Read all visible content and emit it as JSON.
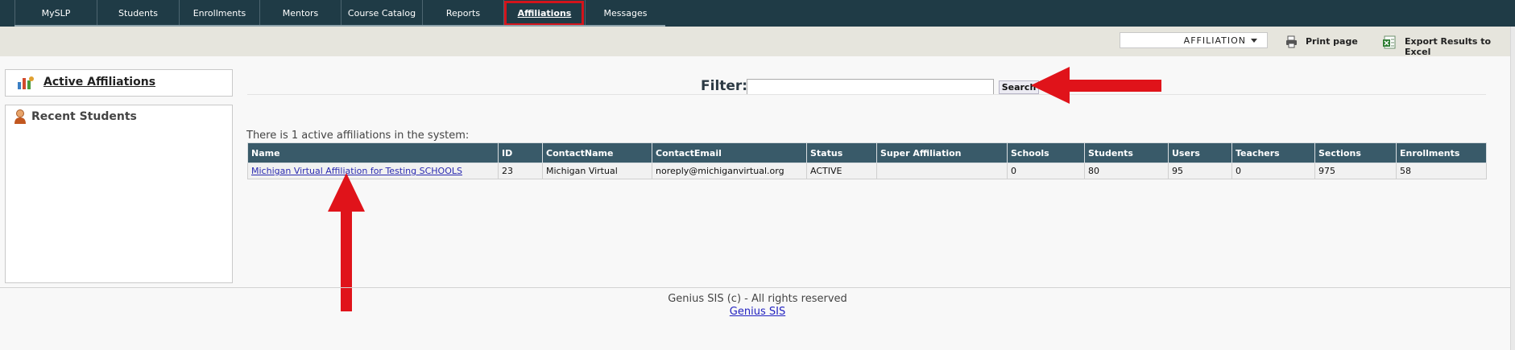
{
  "nav": {
    "tabs": [
      {
        "label": "MySLP"
      },
      {
        "label": "Students"
      },
      {
        "label": "Enrollments"
      },
      {
        "label": "Mentors"
      },
      {
        "label": "Course Catalog"
      },
      {
        "label": "Reports"
      },
      {
        "label": "Affiliations"
      },
      {
        "label": "Messages"
      }
    ],
    "active_tab": "Affiliations"
  },
  "toolbar": {
    "dropdown_value": "AFFILIATION",
    "print_label": "Print page",
    "export_label": "Export Results to Excel"
  },
  "sidebar": {
    "active_affiliations": "Active Affiliations",
    "recent_students": "Recent Students"
  },
  "filter": {
    "label": "Filter:",
    "value": "",
    "search_label": "Search"
  },
  "summary": "There is 1 active affiliations in the system:",
  "table": {
    "columns": [
      "Name",
      "ID",
      "ContactName",
      "ContactEmail",
      "Status",
      "Super Affiliation",
      "Schools",
      "Students",
      "Users",
      "Teachers",
      "Sections",
      "Enrollments"
    ],
    "rows": [
      [
        "Michigan Virtual Affiliation for Testing SCHOOLS",
        "23",
        "Michigan Virtual",
        "noreply@michiganvirtual.org",
        "ACTIVE",
        "",
        "0",
        "80",
        "95",
        "0",
        "975",
        "58"
      ]
    ]
  },
  "footer": {
    "copyright": "Genius SIS (c) - All rights reserved",
    "link": "Genius SIS"
  },
  "colors": {
    "nav_bg": "#1f3b46",
    "highlight": "#d3141b",
    "table_header": "#395a69",
    "arrow": "#e0131a"
  },
  "icons": [
    "people-chart-icon",
    "student-icon",
    "print-icon",
    "excel-icon",
    "caret-down-icon"
  ]
}
